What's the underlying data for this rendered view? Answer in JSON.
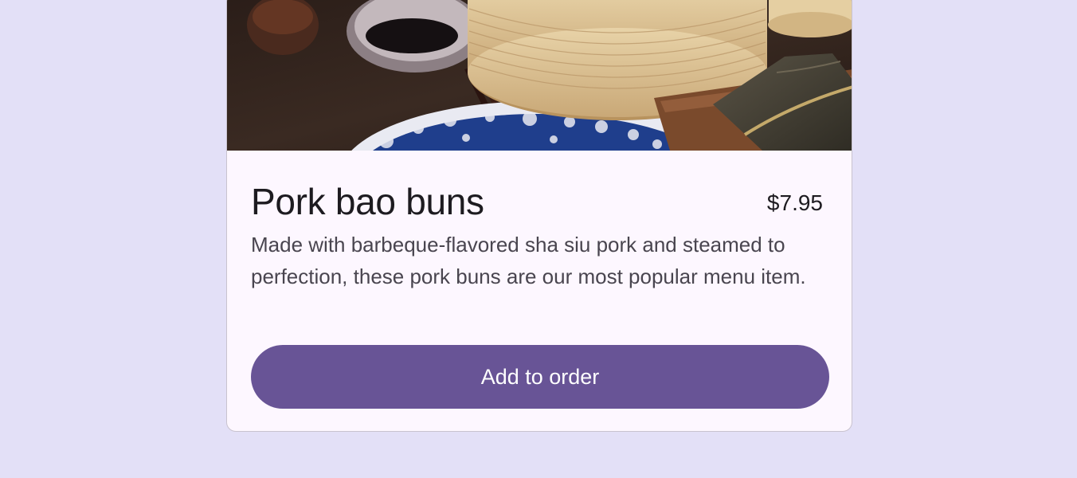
{
  "item": {
    "image_alt": "Steamed pork bao buns in bamboo steamer with soy sauce",
    "title": "Pork bao buns",
    "price": "$7.95",
    "description": "Made with barbeque-flavored sha siu pork and steamed to perfection, these pork buns are our most popular menu item.",
    "add_button_label": "Add to order"
  },
  "colors": {
    "page_background": "#e3e0f7",
    "card_background": "#fdf7ff",
    "button_background": "#685496",
    "title_text": "#1d1b20",
    "body_text": "#49454f"
  }
}
